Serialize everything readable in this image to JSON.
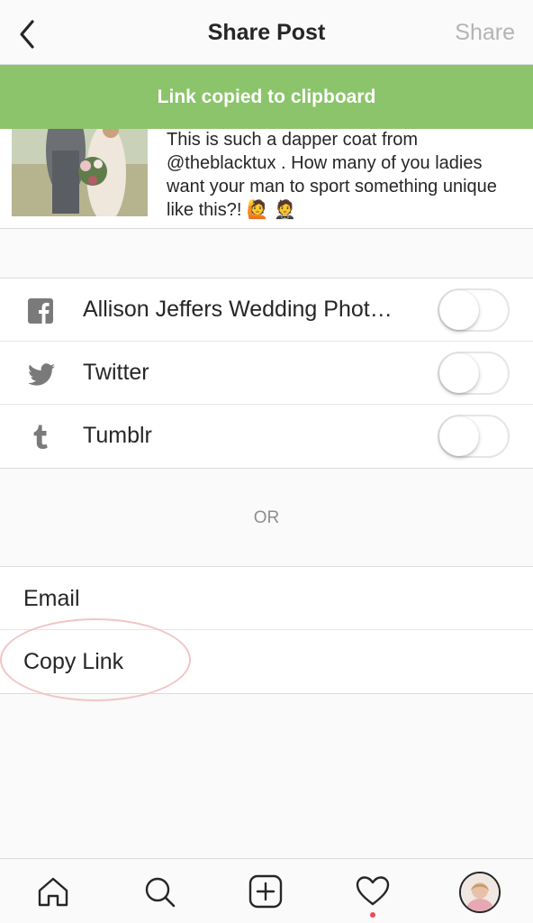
{
  "header": {
    "title": "Share Post",
    "share_label": "Share"
  },
  "toast": {
    "message": "Link copied to clipboard",
    "color": "#8bc46a"
  },
  "post": {
    "caption": "This is such a dapper coat from @theblacktux . How many of you ladies want your man to sport something unique like this?! 🙋 🤵"
  },
  "social": [
    {
      "network": "Facebook",
      "icon": "facebook-icon",
      "label": "Allison Jeffers Wedding Phot…",
      "enabled": false
    },
    {
      "network": "Twitter",
      "icon": "twitter-icon",
      "label": "Twitter",
      "enabled": false
    },
    {
      "network": "Tumblr",
      "icon": "tumblr-icon",
      "label": "Tumblr",
      "enabled": false
    }
  ],
  "divider_text": "OR",
  "actions": {
    "email_label": "Email",
    "copy_link_label": "Copy Link"
  },
  "tabbar": {
    "tabs": [
      "home-icon",
      "search-icon",
      "new-post-icon",
      "activity-heart-icon",
      "profile-avatar"
    ],
    "notification_color": "#ed4956"
  }
}
